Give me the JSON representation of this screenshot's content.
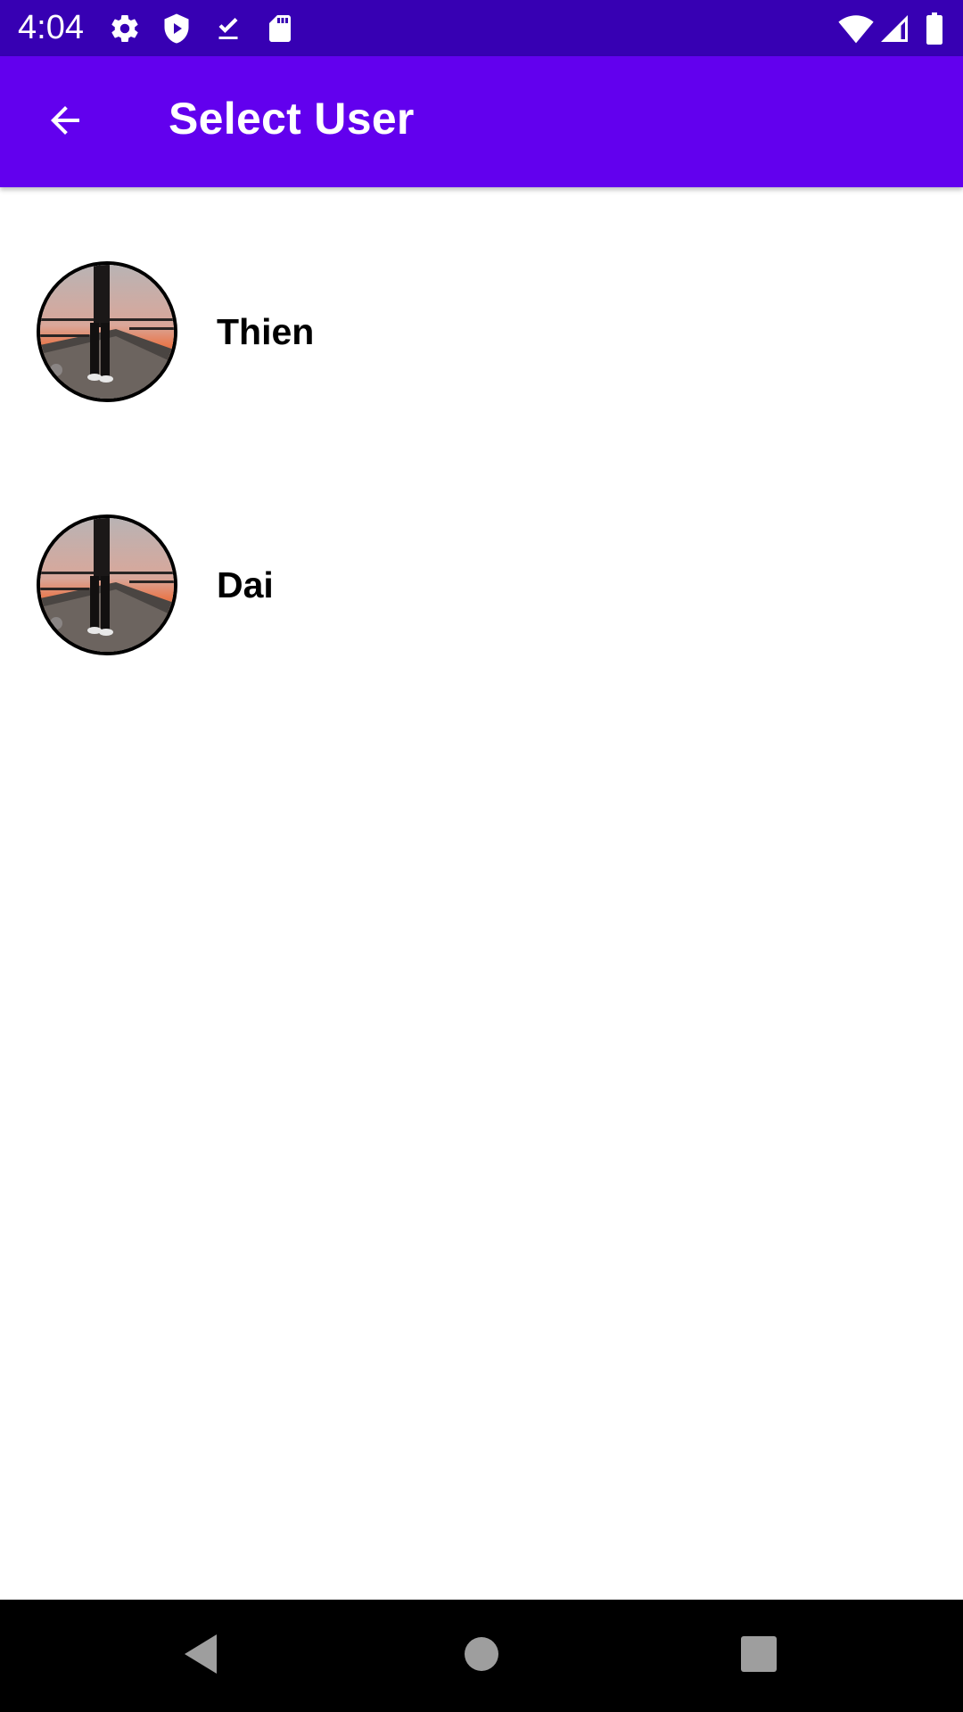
{
  "status_bar": {
    "time": "4:04",
    "left_icons": [
      "gear-icon",
      "shield-play-icon",
      "download-done-icon",
      "sd-card-icon"
    ],
    "right_icons": [
      "wifi-icon",
      "cell-signal-icon",
      "battery-icon"
    ]
  },
  "app_bar": {
    "back_icon": "arrow-back-icon",
    "title": "Select User",
    "color": "#6200ee",
    "status_color": "#3700b3"
  },
  "users": [
    {
      "name": "Thien",
      "avatar": "avatar-photo-person-on-bridge"
    },
    {
      "name": "Dai",
      "avatar": "avatar-photo-person-on-bridge"
    }
  ],
  "nav_bar": {
    "icons": [
      "back-triangle-icon",
      "home-circle-icon",
      "recents-square-icon"
    ]
  }
}
